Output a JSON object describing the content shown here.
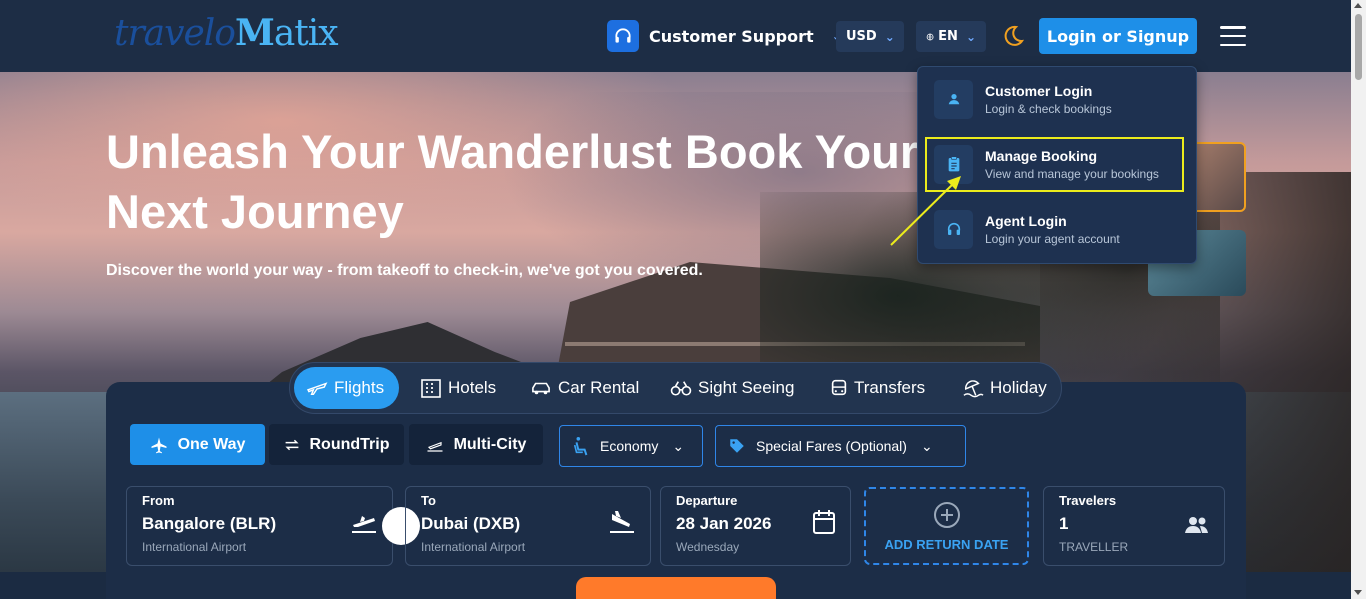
{
  "header": {
    "logo_text_1": "travelo",
    "logo_text_2": "M",
    "logo_text_3": "atix",
    "support_label": "Customer Support",
    "currency": "USD",
    "language": "EN",
    "login_label": "Login or Signup"
  },
  "hero": {
    "title": "Unleash Your Wanderlust Book Your Next Journey",
    "subtitle": "Discover the world your way - from takeoff to check-in, we've got you covered."
  },
  "dropdown": {
    "items": [
      {
        "title": "Customer Login",
        "sub": "Login & check bookings",
        "icon": "user-icon"
      },
      {
        "title": "Manage Booking",
        "sub": "View and manage your bookings",
        "icon": "clipboard-icon"
      },
      {
        "title": "Agent Login",
        "sub": "Login your agent account",
        "icon": "headset-icon"
      }
    ]
  },
  "tabs": [
    {
      "label": "Flights",
      "icon": "plane-icon",
      "active": true
    },
    {
      "label": "Hotels",
      "icon": "building-icon"
    },
    {
      "label": "Car Rental",
      "icon": "car-icon"
    },
    {
      "label": "Sight Seeing",
      "icon": "binoculars-icon"
    },
    {
      "label": "Transfers",
      "icon": "bus-icon"
    },
    {
      "label": "Holiday",
      "icon": "beach-icon"
    }
  ],
  "trip_types": [
    {
      "label": "One Way",
      "active": true
    },
    {
      "label": "RoundTrip"
    },
    {
      "label": "Multi-City"
    }
  ],
  "cabin": {
    "label": "Economy"
  },
  "fares": {
    "label": "Special Fares (Optional)"
  },
  "from": {
    "label": "From",
    "value": "Bangalore (BLR)",
    "sub": "International Airport"
  },
  "to": {
    "label": "To",
    "value": "Dubai (DXB)",
    "sub": "International Airport"
  },
  "departure": {
    "label": "Departure",
    "value": "28 Jan 2026",
    "sub": "Wednesday"
  },
  "return": {
    "label": "ADD RETURN DATE"
  },
  "travelers": {
    "label": "Travelers",
    "value": "1",
    "sub": "TRAVELLER"
  },
  "colors": {
    "accent": "#1e8fe8",
    "highlight": "#ecec1c",
    "cta": "#ff7a2a"
  }
}
